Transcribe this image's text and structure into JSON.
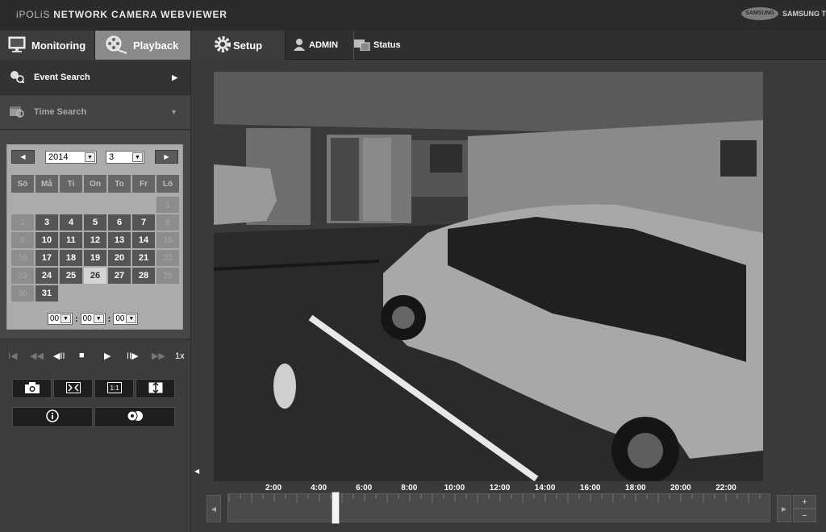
{
  "header": {
    "brand_prefix": "iPOLiS",
    "brand_title": "NETWORK CAMERA WEBVIEWER",
    "vendor_logo": "SAMSUNG",
    "vendor_text": "SAMSUNG TE"
  },
  "nav": {
    "tabs": [
      {
        "label": "Monitoring",
        "icon": "monitor-icon"
      },
      {
        "label": "Playback",
        "icon": "film-reel-icon",
        "active": true
      },
      {
        "label": "Setup",
        "icon": "gear-icon"
      }
    ],
    "user_label": "ADMIN",
    "status_label": "Status"
  },
  "sidebar": {
    "event_search_label": "Event Search",
    "time_search_label": "Time Search"
  },
  "calendar": {
    "year": "2014",
    "month": "3",
    "weekdays": [
      "Sö",
      "Må",
      "Ti",
      "On",
      "To",
      "Fr",
      "Lö"
    ],
    "selected_day": "26",
    "leading_other": [
      "1"
    ],
    "rows": [
      [
        {
          "d": "2",
          "o": true
        },
        {
          "d": "3"
        },
        {
          "d": "4"
        },
        {
          "d": "5"
        },
        {
          "d": "6"
        },
        {
          "d": "7"
        },
        {
          "d": "8",
          "o": true
        }
      ],
      [
        {
          "d": "9",
          "o": true
        },
        {
          "d": "10"
        },
        {
          "d": "11"
        },
        {
          "d": "12"
        },
        {
          "d": "13"
        },
        {
          "d": "14"
        },
        {
          "d": "15",
          "o": true
        }
      ],
      [
        {
          "d": "16",
          "o": true
        },
        {
          "d": "17"
        },
        {
          "d": "18"
        },
        {
          "d": "19"
        },
        {
          "d": "20"
        },
        {
          "d": "21"
        },
        {
          "d": "22",
          "o": true
        }
      ],
      [
        {
          "d": "23",
          "o": true
        },
        {
          "d": "24"
        },
        {
          "d": "25"
        },
        {
          "d": "26",
          "s": true
        },
        {
          "d": "27"
        },
        {
          "d": "28"
        },
        {
          "d": "29",
          "o": true
        }
      ],
      [
        {
          "d": "30",
          "o": true
        },
        {
          "d": "31"
        }
      ]
    ],
    "time": {
      "hour": "00",
      "minute": "00",
      "second": "00"
    }
  },
  "playback": {
    "speed": "1x"
  },
  "timeline": {
    "labels": [
      "2:00",
      "4:00",
      "6:00",
      "8:00",
      "10:00",
      "12:00",
      "14:00",
      "16:00",
      "18:00",
      "20:00",
      "22:00"
    ],
    "zoom_in": "+",
    "zoom_out": "−"
  }
}
